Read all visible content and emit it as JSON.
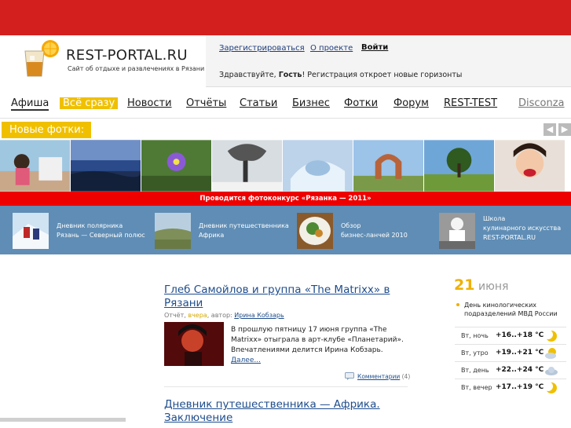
{
  "header": {
    "logo_title": "REST-PORTAL.RU",
    "logo_subtitle": "Сайт об отдыхе и развлечениях в Рязани",
    "register_link": "Зарегистрироваться",
    "about_link": "О проекте",
    "login_link": "Войти",
    "greeting_prefix": "Здравствуйте,",
    "greeting_name": "Гость",
    "greeting_suffix": "! Регистрация откроет новые горизонты"
  },
  "nav": {
    "items": [
      "Афиша",
      "Всё сразу",
      "Новости",
      "Отчёты",
      "Статьи",
      "Бизнес",
      "Фотки",
      "Форум",
      "REST-TEST",
      "Disconza"
    ]
  },
  "photos": {
    "label": "Новые фотки:",
    "prev_icon": "arrow-left-icon",
    "next_icon": "arrow-right-icon"
  },
  "contest_banner": "Проводится фотоконкурс «Рязанка — 2011»",
  "featured": [
    {
      "line1": "Дневник полярника",
      "line2": "Рязань — Северный полюс"
    },
    {
      "line1": "Дневник путешественника",
      "line2": "Африка"
    },
    {
      "line1": "Обзор",
      "line2": "бизнес-ланчей 2010"
    },
    {
      "line1": "Школа",
      "line2": "кулинарного искусства",
      "line3": "REST-PORTAL.RU"
    }
  ],
  "articles": [
    {
      "title_line1": "Глеб Самойлов и группа «The Matrixx» в",
      "title_line2": "Рязани",
      "meta_type": "Отчёт,",
      "meta_when": "вчера",
      "meta_author_prefix": ", автор:",
      "meta_author": "Ирина Кобзарь",
      "text_line1": "В прошлую пятницу 17 июня группа «The",
      "text_line2": "Matrixx» отыграла в арт-клубе «Планетарий».",
      "text_line3": "Впечатлениями делится Ирина Кобзарь.",
      "more": "Далее...",
      "comments_label": "Комментарии",
      "comments_count": "(4)"
    },
    {
      "title_line1": "Дневник путешественника — Африка.",
      "title_line2": "Заключение"
    }
  ],
  "sidebar": {
    "date_day": "21",
    "date_month": "июня",
    "holiday_line1": "День кинологических",
    "holiday_line2": "подразделений МВД России",
    "weather": [
      {
        "time": "Вт, ночь",
        "temp": "+16..+18 °C",
        "icon": "moon-icon"
      },
      {
        "time": "Вт, утро",
        "temp": "+19..+21 °C",
        "icon": "sun-cloud-icon"
      },
      {
        "time": "Вт, день",
        "temp": "+22..+24 °C",
        "icon": "cloud-icon"
      },
      {
        "time": "Вт, вечер",
        "temp": "+17..+19 °C",
        "icon": "moon-icon"
      }
    ]
  },
  "colors": {
    "top_bar": "#d41f1f",
    "accent_yellow": "#f0c000",
    "banner_red": "#ee0000",
    "featured_band": "#5f8db5",
    "link_blue": "#1e4d8c"
  }
}
